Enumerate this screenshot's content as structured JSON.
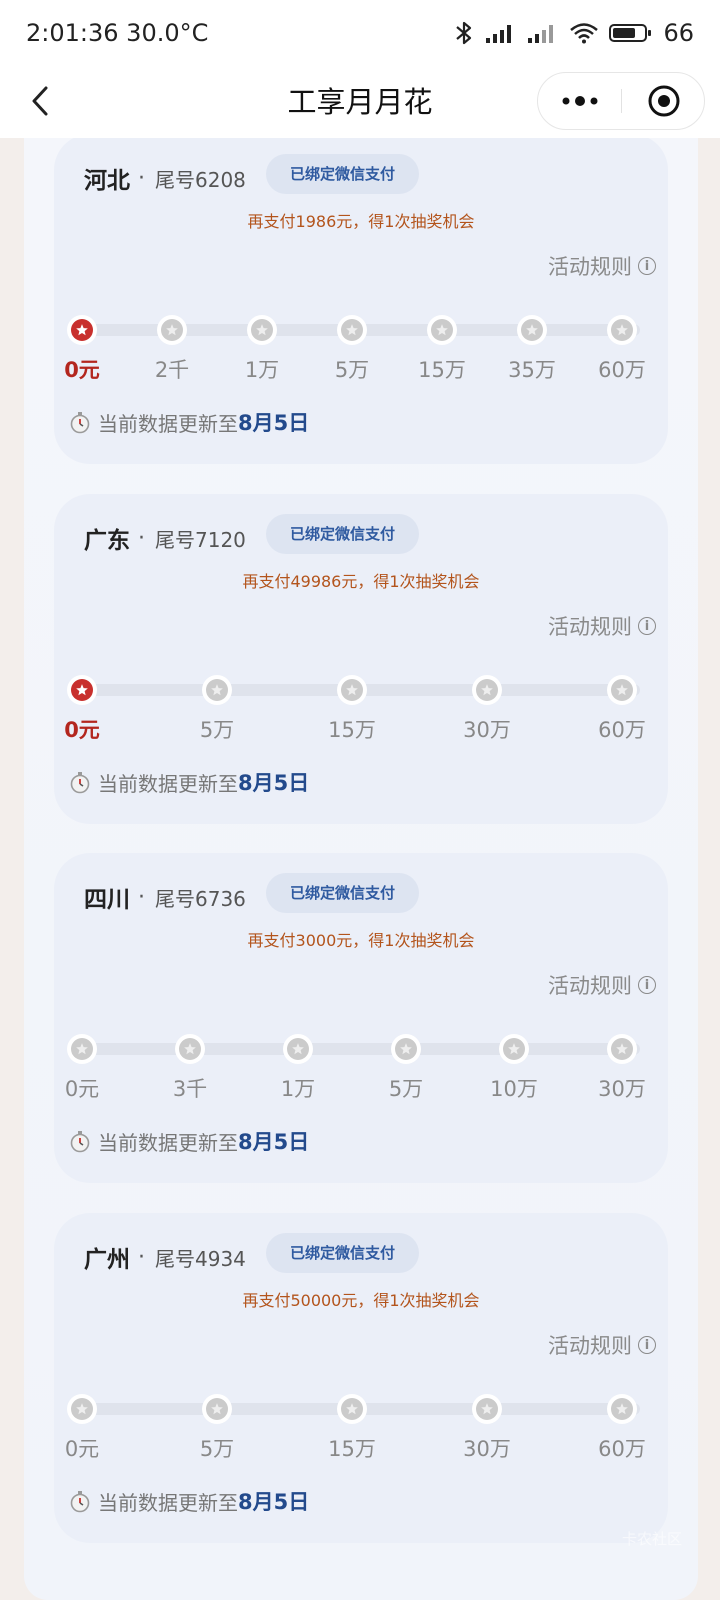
{
  "status_bar": {
    "time": "2:01:36",
    "temperature": "30.0°C",
    "battery": "66"
  },
  "nav": {
    "title": "工享月月花"
  },
  "cards": [
    {
      "province": "河北",
      "tail_label": "尾号6208",
      "badge": "已绑定微信支付",
      "promo": "再支付1986元，得1次抽奖机会",
      "rules_label": "活动规则",
      "milestones": [
        "0元",
        "2千",
        "1万",
        "5万",
        "15万",
        "35万",
        "60万"
      ],
      "active_index": 0,
      "update_prefix": "当前数据更新至",
      "update_date": "8月5日"
    },
    {
      "province": "广东",
      "tail_label": "尾号7120",
      "badge": "已绑定微信支付",
      "promo": "再支付49986元，得1次抽奖机会",
      "rules_label": "活动规则",
      "milestones": [
        "0元",
        "5万",
        "15万",
        "30万",
        "60万"
      ],
      "active_index": 0,
      "update_prefix": "当前数据更新至",
      "update_date": "8月5日"
    },
    {
      "province": "四川",
      "tail_label": "尾号6736",
      "badge": "已绑定微信支付",
      "promo": "再支付3000元，得1次抽奖机会",
      "rules_label": "活动规则",
      "milestones": [
        "0元",
        "3千",
        "1万",
        "5万",
        "10万",
        "30万"
      ],
      "active_index": -1,
      "update_prefix": "当前数据更新至",
      "update_date": "8月5日"
    },
    {
      "province": "广州",
      "tail_label": "尾号4934",
      "badge": "已绑定微信支付",
      "promo": "再支付50000元，得1次抽奖机会",
      "rules_label": "活动规则",
      "milestones": [
        "0元",
        "5万",
        "15万",
        "30万",
        "60万"
      ],
      "active_index": -1,
      "update_prefix": "当前数据更新至",
      "update_date": "8月5日"
    }
  ],
  "colors": {
    "accent_red": "#c8302d",
    "badge_blue": "#2f5aa0",
    "promo_orange": "#b3541c"
  }
}
